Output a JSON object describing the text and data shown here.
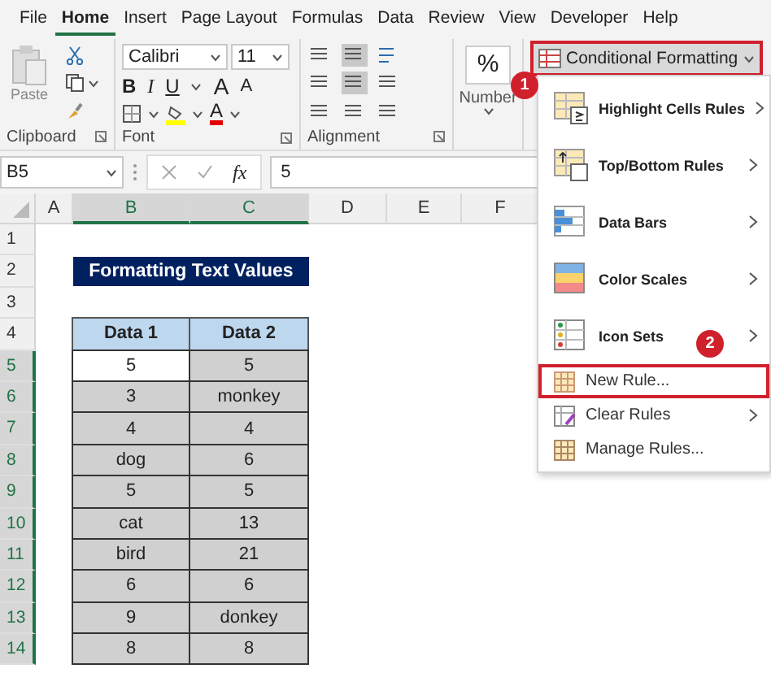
{
  "ribbon_tabs": [
    {
      "label": "File",
      "selected": false
    },
    {
      "label": "Home",
      "selected": true
    },
    {
      "label": "Insert",
      "selected": false
    },
    {
      "label": "Page Layout",
      "selected": false
    },
    {
      "label": "Formulas",
      "selected": false
    },
    {
      "label": "Data",
      "selected": false
    },
    {
      "label": "Review",
      "selected": false
    },
    {
      "label": "View",
      "selected": false
    },
    {
      "label": "Developer",
      "selected": false
    },
    {
      "label": "Help",
      "selected": false
    }
  ],
  "clipboard": {
    "paste": "Paste",
    "group": "Clipboard"
  },
  "font": {
    "name": "Calibri",
    "size": "11",
    "bold": "B",
    "italic": "I",
    "underline": "U",
    "grow": "A",
    "shrink": "A",
    "color_letter": "A",
    "group": "Font"
  },
  "alignment": {
    "group": "Alignment"
  },
  "number": {
    "symbol": "%",
    "label": "Number"
  },
  "conditional_formatting": {
    "label": "Conditional Formatting",
    "highlighted": true
  },
  "formula_bar": {
    "name_box": "B5",
    "fx": "fx",
    "value": "5"
  },
  "columns": [
    {
      "label": "A",
      "selected": false
    },
    {
      "label": "B",
      "selected": true
    },
    {
      "label": "C",
      "selected": true
    },
    {
      "label": "D",
      "selected": false
    },
    {
      "label": "E",
      "selected": false
    },
    {
      "label": "F",
      "selected": false
    }
  ],
  "rows": [
    {
      "label": "1",
      "selected": false
    },
    {
      "label": "2",
      "selected": false
    },
    {
      "label": "3",
      "selected": false
    },
    {
      "label": "4",
      "selected": false
    },
    {
      "label": "5",
      "selected": true
    },
    {
      "label": "6",
      "selected": true
    },
    {
      "label": "7",
      "selected": true
    },
    {
      "label": "8",
      "selected": true
    },
    {
      "label": "9",
      "selected": true
    },
    {
      "label": "10",
      "selected": true
    },
    {
      "label": "11",
      "selected": true
    },
    {
      "label": "12",
      "selected": true
    },
    {
      "label": "13",
      "selected": true
    },
    {
      "label": "14",
      "selected": true
    }
  ],
  "sheet": {
    "title": "Formatting Text Values",
    "headers": [
      "Data 1",
      "Data 2"
    ],
    "data": [
      {
        "cells": [
          "5",
          "5"
        ],
        "active": true
      },
      {
        "cells": [
          "3",
          "monkey"
        ],
        "active": false
      },
      {
        "cells": [
          "4",
          "4"
        ],
        "active": false
      },
      {
        "cells": [
          "dog",
          "6"
        ],
        "active": false
      },
      {
        "cells": [
          "5",
          "5"
        ],
        "active": false
      },
      {
        "cells": [
          "cat",
          "13"
        ],
        "active": false
      },
      {
        "cells": [
          "bird",
          "21"
        ],
        "active": false
      },
      {
        "cells": [
          "6",
          "6"
        ],
        "active": false
      },
      {
        "cells": [
          "9",
          "donkey"
        ],
        "active": false
      },
      {
        "cells": [
          "8",
          "8"
        ],
        "active": false
      }
    ]
  },
  "menu": [
    {
      "label": "Highlight Cells Rules",
      "kind": "large",
      "submenu": true,
      "highlighted": false
    },
    {
      "label": "Top/Bottom Rules",
      "kind": "large",
      "submenu": true,
      "highlighted": false
    },
    {
      "label": "Data Bars",
      "kind": "large",
      "submenu": true,
      "highlighted": false
    },
    {
      "label": "Color Scales",
      "kind": "large",
      "submenu": true,
      "highlighted": false
    },
    {
      "label": "Icon Sets",
      "kind": "large",
      "submenu": true,
      "highlighted": false
    },
    {
      "label": "New Rule...",
      "kind": "small",
      "submenu": false,
      "highlighted": true
    },
    {
      "label": "Clear Rules",
      "kind": "small",
      "submenu": true,
      "highlighted": false
    },
    {
      "label": "Manage Rules...",
      "kind": "small",
      "submenu": false,
      "highlighted": false
    }
  ],
  "callouts": [
    "1",
    "2"
  ]
}
